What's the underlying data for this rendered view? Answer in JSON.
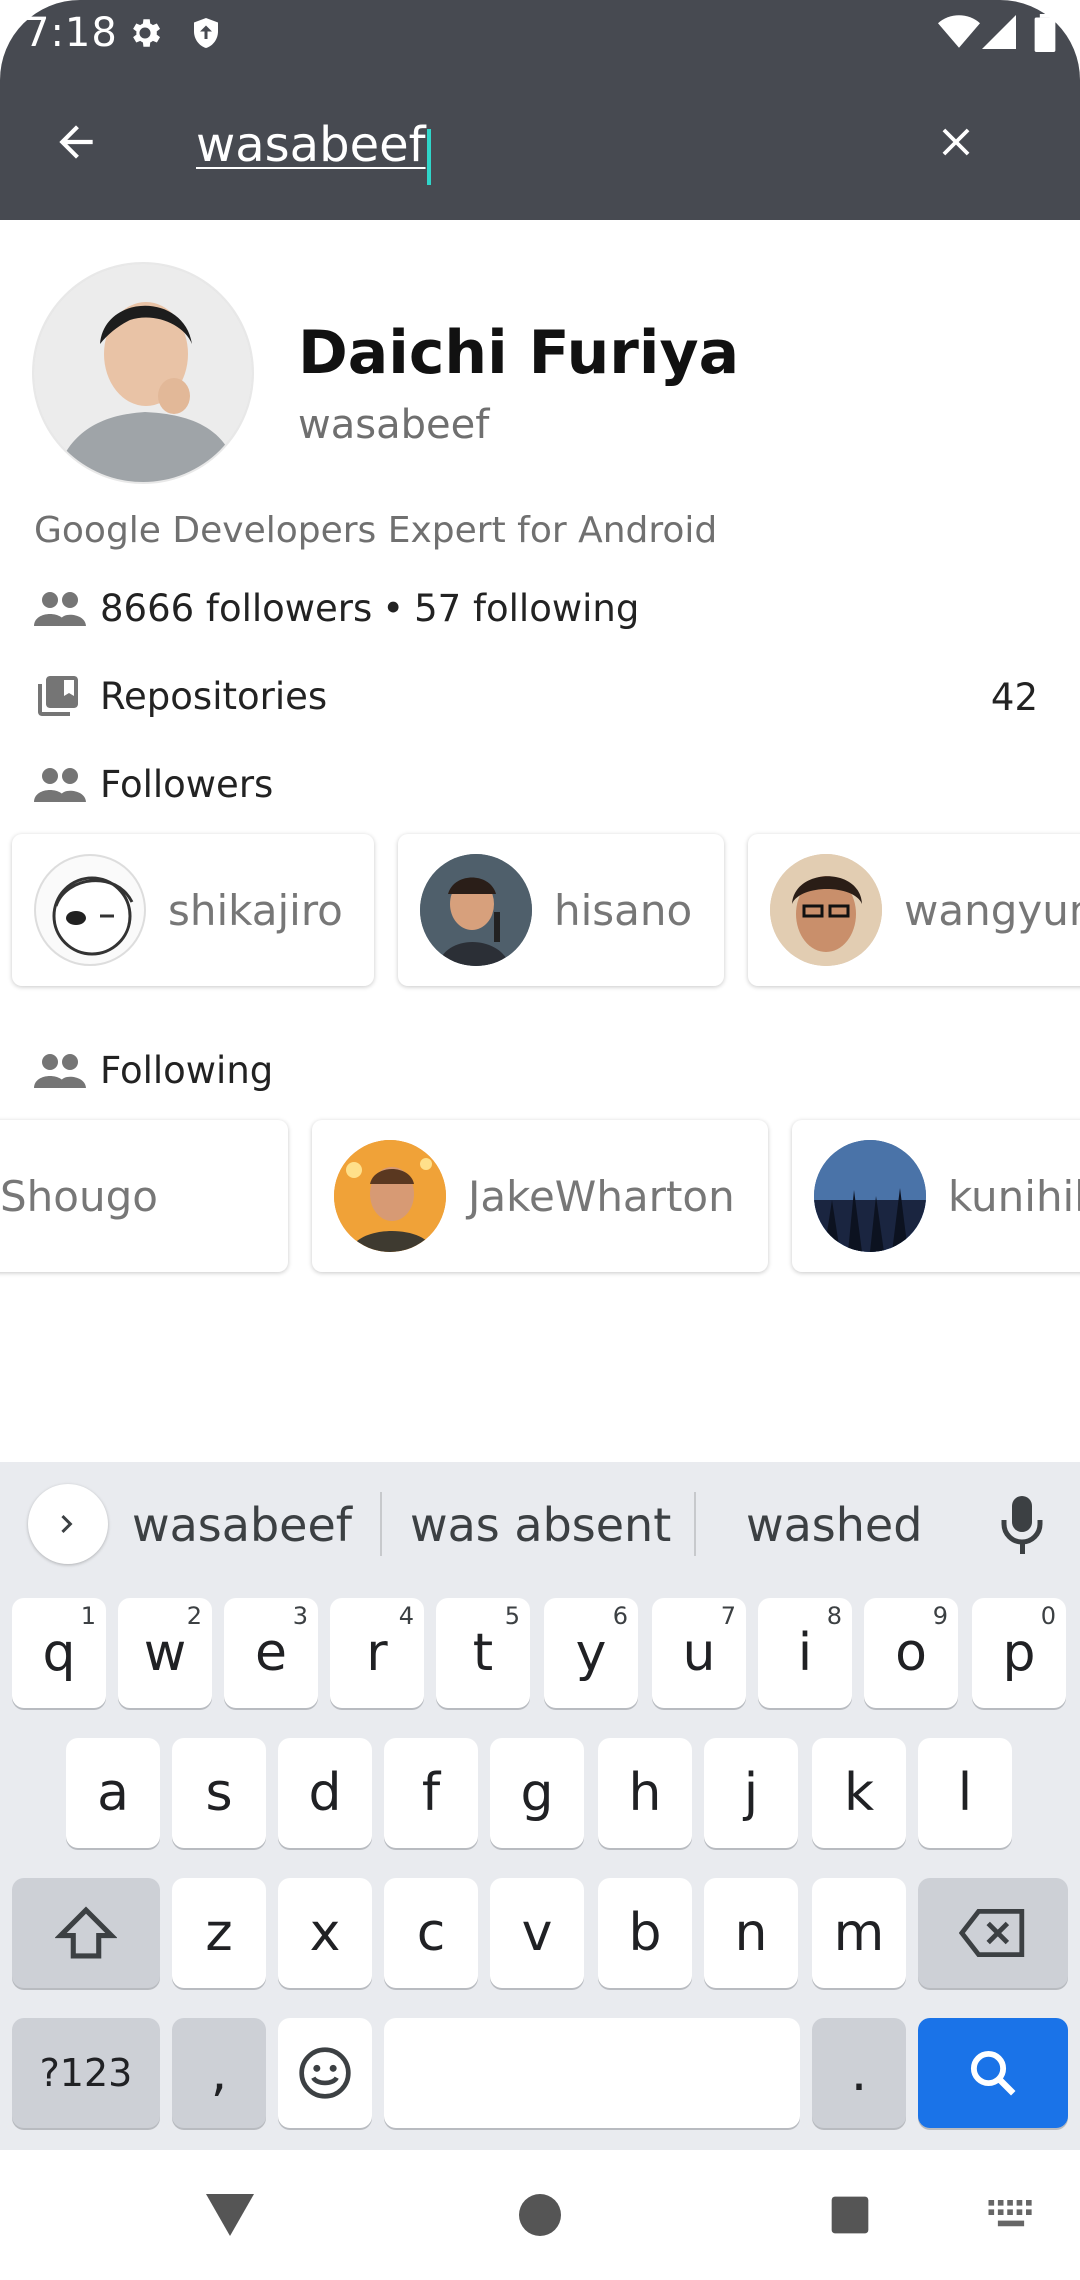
{
  "status_bar": {
    "time": "7:18"
  },
  "search": {
    "query": "wasabeef"
  },
  "profile": {
    "name": "Daichi Furiya",
    "login": "wasabeef",
    "bio": "Google Developers Expert for Android",
    "followers_text": "8666 followers",
    "separator": "•",
    "following_text": "57 following"
  },
  "sections": {
    "repositories_label": "Repositories",
    "repositories_count": "42",
    "followers_label": "Followers",
    "following_label": "Following"
  },
  "followers": [
    {
      "login": "shikajiro"
    },
    {
      "login": "hisano"
    },
    {
      "login": "wangyung"
    }
  ],
  "following": [
    {
      "login": "Shougo"
    },
    {
      "login": "JakeWharton"
    },
    {
      "login": "kunihiko"
    }
  ],
  "keyboard": {
    "suggestions": [
      "wasabeef",
      "was absent",
      "washed"
    ],
    "row1": [
      {
        "k": "q",
        "h": "1"
      },
      {
        "k": "w",
        "h": "2"
      },
      {
        "k": "e",
        "h": "3"
      },
      {
        "k": "r",
        "h": "4"
      },
      {
        "k": "t",
        "h": "5"
      },
      {
        "k": "y",
        "h": "6"
      },
      {
        "k": "u",
        "h": "7"
      },
      {
        "k": "i",
        "h": "8"
      },
      {
        "k": "o",
        "h": "9"
      },
      {
        "k": "p",
        "h": "0"
      }
    ],
    "row2": [
      "a",
      "s",
      "d",
      "f",
      "g",
      "h",
      "j",
      "k",
      "l"
    ],
    "row3": [
      "z",
      "x",
      "c",
      "v",
      "b",
      "n",
      "m"
    ],
    "symbols_label": "?123",
    "comma_label": ",",
    "period_label": "."
  },
  "colors": {
    "appbar": "#474a51",
    "caret": "#2fd5c9",
    "search_key": "#1a73e8"
  }
}
